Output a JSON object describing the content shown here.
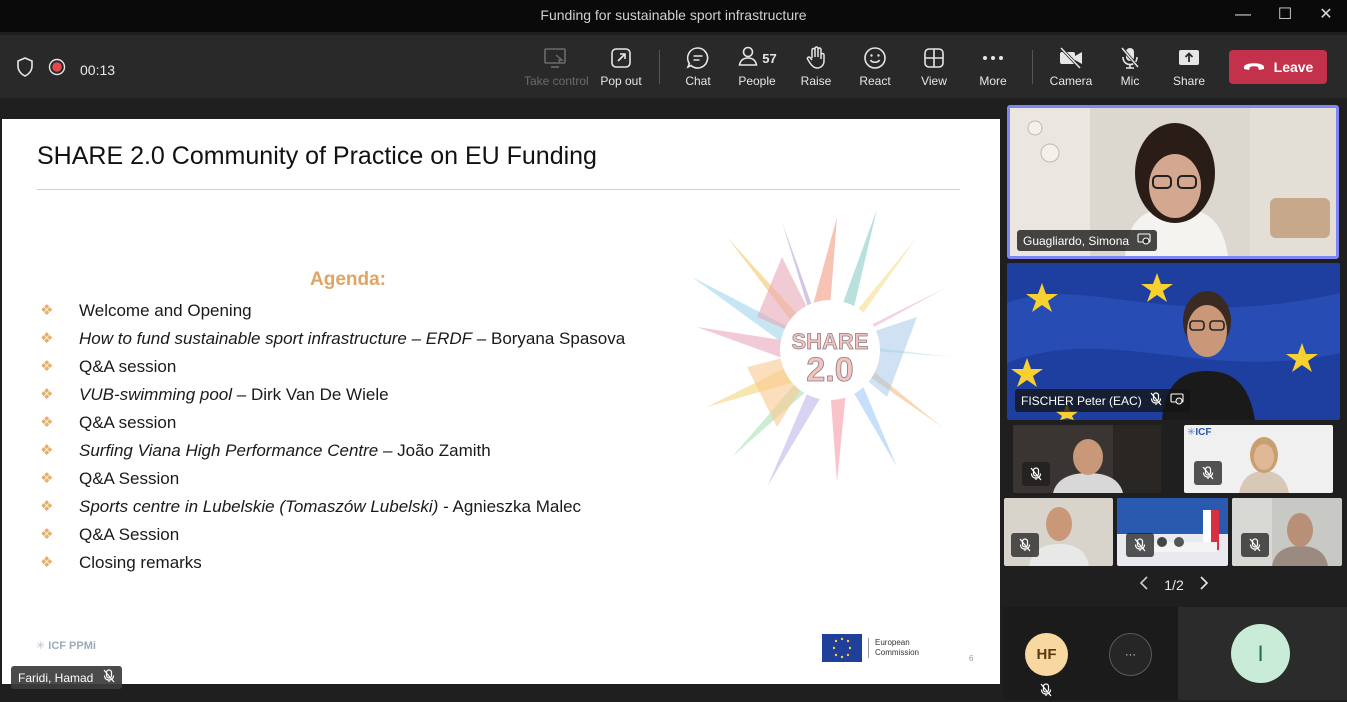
{
  "window": {
    "title": "Funding for sustainable sport infrastructure"
  },
  "toolbar": {
    "timer": "00:13",
    "take_control": "Take control",
    "pop_out": "Pop out",
    "chat": "Chat",
    "people": "People",
    "people_count": "57",
    "raise": "Raise",
    "react": "React",
    "view": "View",
    "more": "More",
    "camera": "Camera",
    "mic": "Mic",
    "share": "Share",
    "leave": "Leave"
  },
  "slide": {
    "title": "SHARE 2.0 Community of Practice on EU Funding",
    "agenda_heading": "Agenda:",
    "items": [
      {
        "italic": "",
        "text": "Welcome and Opening"
      },
      {
        "italic": "How to fund sustainable sport infrastructure – ERDF",
        "text": " – Boryana Spasova"
      },
      {
        "italic": "",
        "text": "Q&A session"
      },
      {
        "italic": "VUB-swimming pool",
        "text": " – Dirk Van De Wiele"
      },
      {
        "italic": "",
        "text": "Q&A session"
      },
      {
        "italic": "Surfing Viana High Performance Centre",
        "text": " – João Zamith"
      },
      {
        "italic": "",
        "text": "Q&A Session"
      },
      {
        "italic": "Sports centre in Lubelskie (Tomaszów Lubelski)",
        "text": " - Agnieszka Malec"
      },
      {
        "italic": "",
        "text": "Q&A Session"
      },
      {
        "italic": "",
        "text": "Closing remarks"
      }
    ],
    "logo_text": "SHARE",
    "logo_version": "2.0",
    "icf_logo": "ICF PPMi",
    "ec_logo_line1": "European",
    "ec_logo_line2": "Commission",
    "page_number": "6"
  },
  "presenter": {
    "name": "Faridi, Hamad"
  },
  "participants": {
    "spotlight_name": "Guagliardo, Simona",
    "second_name": "FISCHER Peter (EAC)",
    "tile_logo": "ICF"
  },
  "pager": {
    "label": "1/2"
  },
  "bottom": {
    "avatar_hf": "HF",
    "more_dots": "···",
    "avatar_i": "I"
  },
  "colors": {
    "leave": "#c4314b",
    "spotlight_border": "#7f85f5",
    "agenda_heading": "#e0a464",
    "avatar_bg": "#f8d8a0",
    "avatar_i_bg": "#c8ecd8"
  }
}
